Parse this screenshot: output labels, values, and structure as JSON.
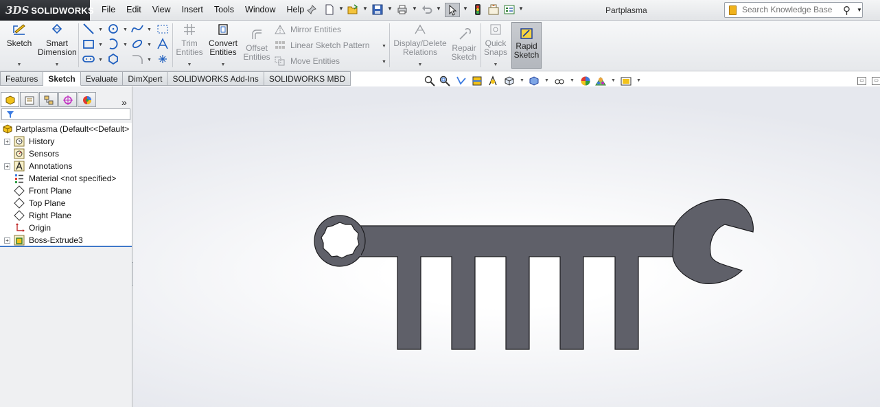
{
  "app": {
    "brand": "SOLIDWORKS",
    "brand_mark": "3DS",
    "document_title": "Partplasma"
  },
  "menu": [
    "File",
    "Edit",
    "View",
    "Insert",
    "Tools",
    "Window",
    "Help"
  ],
  "search": {
    "placeholder": "Search Knowledge Base"
  },
  "command_manager": {
    "sketch": "Sketch",
    "smart_dimension_1": "Smart",
    "smart_dimension_2": "Dimension",
    "trim_1": "Trim",
    "trim_2": "Entities",
    "convert_1": "Convert",
    "convert_2": "Entities",
    "offset_1": "Offset",
    "offset_2": "Entities",
    "mirror": "Mirror Entities",
    "linear_pattern": "Linear Sketch Pattern",
    "move": "Move Entities",
    "display_delete_1": "Display/Delete",
    "display_delete_2": "Relations",
    "repair_1": "Repair",
    "repair_2": "Sketch",
    "quick_snaps_1": "Quick",
    "quick_snaps_2": "Snaps",
    "rapid_1": "Rapid",
    "rapid_2": "Sketch"
  },
  "tabs": [
    {
      "label": "Features",
      "active": false
    },
    {
      "label": "Sketch",
      "active": true
    },
    {
      "label": "Evaluate",
      "active": false
    },
    {
      "label": "DimXpert",
      "active": false
    },
    {
      "label": "SOLIDWORKS Add-Ins",
      "active": false
    },
    {
      "label": "SOLIDWORKS MBD",
      "active": false
    }
  ],
  "feature_tree": {
    "root": "Partplasma  (Default<<Default>",
    "items": [
      {
        "label": "History",
        "icon": "history-icon",
        "expandable": true
      },
      {
        "label": "Sensors",
        "icon": "sensors-icon",
        "expandable": false
      },
      {
        "label": "Annotations",
        "icon": "annotations-icon",
        "expandable": true
      },
      {
        "label": "Material <not specified>",
        "icon": "material-icon",
        "expandable": false
      },
      {
        "label": "Front Plane",
        "icon": "plane-icon",
        "expandable": false
      },
      {
        "label": "Top Plane",
        "icon": "plane-icon",
        "expandable": false
      },
      {
        "label": "Right Plane",
        "icon": "plane-icon",
        "expandable": false
      },
      {
        "label": "Origin",
        "icon": "origin-icon",
        "expandable": false
      },
      {
        "label": "Boss-Extrude3",
        "icon": "extrude-icon",
        "expandable": true
      }
    ]
  },
  "colors": {
    "model_fill": "#5f6069",
    "accent": "#3f78c9",
    "selected_tool": "#b8bcc2"
  }
}
